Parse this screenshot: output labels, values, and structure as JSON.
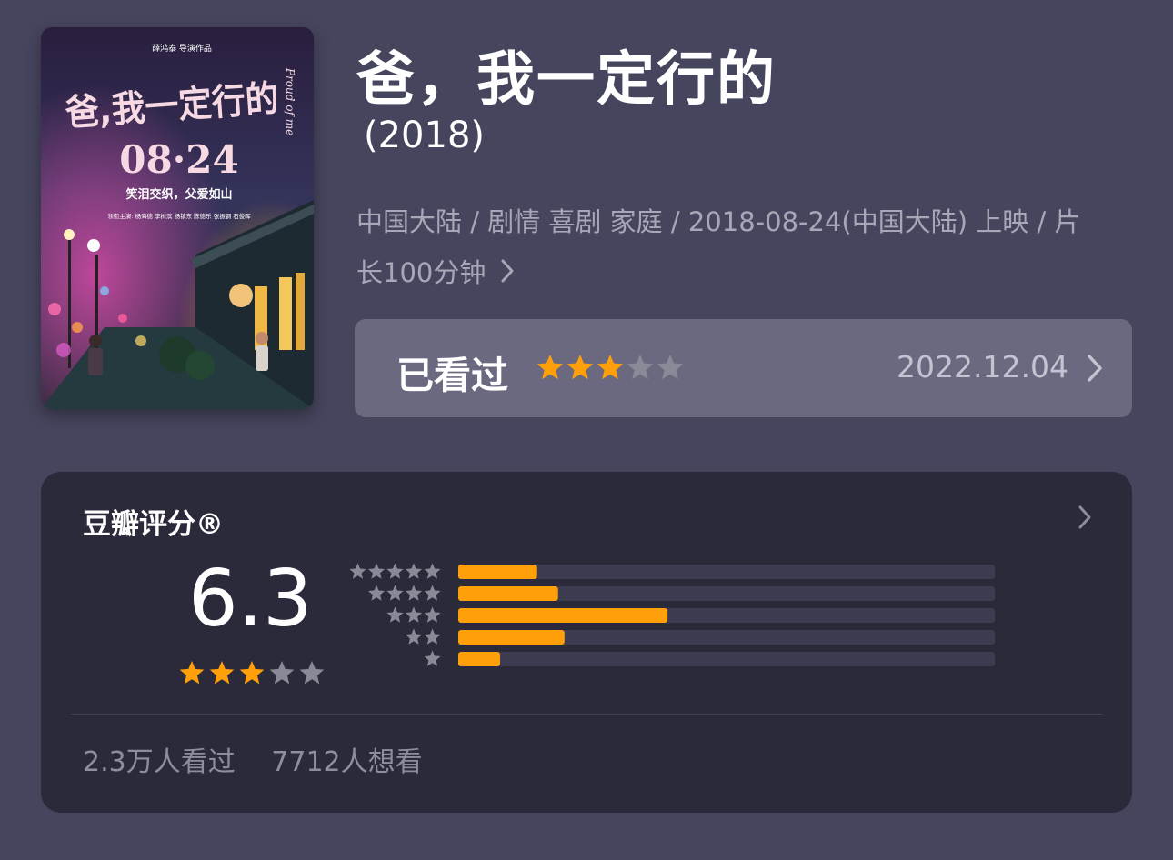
{
  "movie": {
    "title": "爸，我一定行的",
    "year": "(2018)",
    "meta": "中国大陆 / 剧情 喜剧 家庭 / 2018-08-24(中国大陆) 上映 / 片长100分钟",
    "poster": {
      "director_credit": "薛鸿泰 导演作品",
      "title": "爸,我一定行的",
      "english_title": "Proud of me",
      "date": "08·24",
      "tagline": "笑泪交织，父爱如山",
      "cast_line": "领衔主演: 杨海德 李树滨 杨镇东 陈德乐 张振钢 石俊晖"
    }
  },
  "watched": {
    "label": "已看过",
    "user_rating_stars": 3,
    "date": "2022.12.04"
  },
  "rating": {
    "title": "豆瓣评分®",
    "score": "6.3",
    "score_stars": 3,
    "distribution": [
      {
        "stars": 5,
        "fraction": 0.147
      },
      {
        "stars": 4,
        "fraction": 0.186
      },
      {
        "stars": 3,
        "fraction": 0.39
      },
      {
        "stars": 2,
        "fraction": 0.198
      },
      {
        "stars": 1,
        "fraction": 0.078
      }
    ],
    "watched_count": "2.3万人看过",
    "wish_count": "7712人想看"
  },
  "colors": {
    "background": "#46455e",
    "card": "#2b2a3b",
    "accent_orange": "#ff9f0a",
    "star_inactive": "#8a8998",
    "bar_track": "#3c3b4f"
  }
}
